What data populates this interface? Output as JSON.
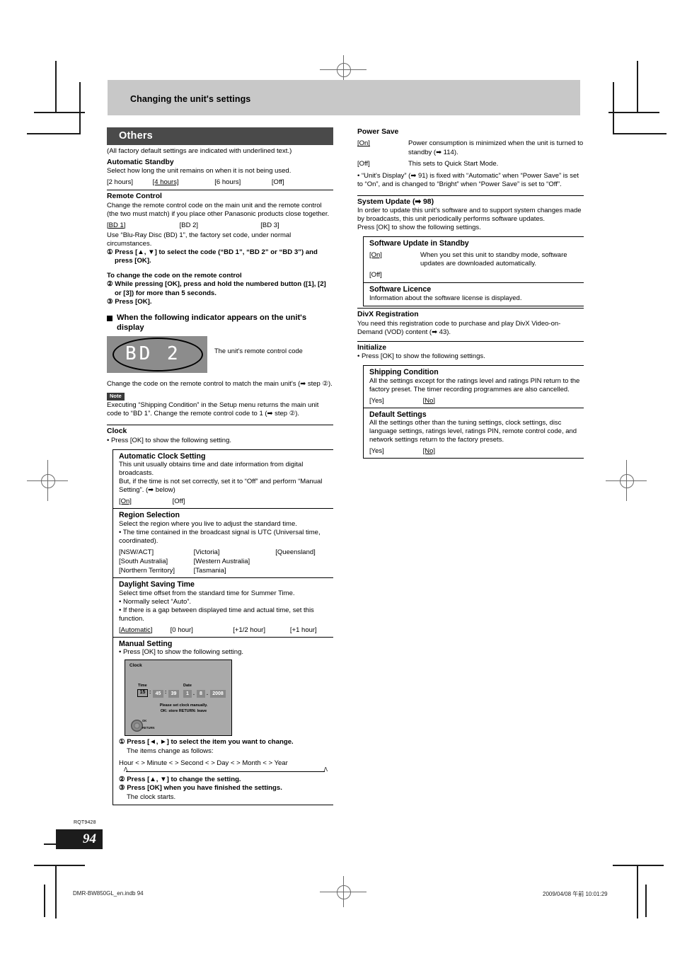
{
  "page": {
    "chapter": "Changing the unit's settings",
    "number": "94",
    "doc_code": "RQT9428",
    "footer_left": "DMR-BW850GL_en.indb   94",
    "footer_right": "2009/04/08   午前 10:01:29"
  },
  "left": {
    "section_title": "Others",
    "factory_note": "(All factory default settings are indicated with underlined text.)",
    "automatic_standby": {
      "title": "Automatic Standby",
      "body": "Select how long the unit remains on when it is not being used.",
      "options": [
        "[2 hours]",
        "[4 hours]",
        "[6 hours]",
        "[Off]"
      ],
      "default": "[4 hours]"
    },
    "remote_control": {
      "title": "Remote Control",
      "body": "Change the remote control code on the main unit and the remote control (the two must match) if you place other Panasonic products close together.",
      "options": [
        "[BD 1]",
        "[BD 2]",
        "[BD 3]"
      ],
      "default": "[BD 1]",
      "body2": "Use “Blu-Ray Disc (BD) 1”, the factory set code, under normal circumstances.",
      "step1": "① Press [▲, ▼] to select the code (“BD 1”, “BD 2” or “BD 3”) and press [OK].",
      "sub_head": "To change the code on the remote control",
      "step2": "② While pressing [OK], press and hold the numbered button ([1], [2] or [3]) for more than 5 seconds.",
      "step3": "③ Press [OK].",
      "indicator_head": "When the following indicator appears on the unit's display",
      "display_value": "BD 2",
      "display_caption": "The unit's remote control code",
      "after_display": "Change the code on the remote control to match the main unit's (➡ step ②).",
      "note_badge": "Note",
      "note_text": "Executing “Shipping Condition” in the Setup menu returns the main unit code to “BD 1”. Change the remote control code to 1 (➡ step ②)."
    },
    "clock": {
      "title": "Clock",
      "body": "• Press [OK] to show the following setting.",
      "automatic_clock_setting": {
        "title": "Automatic Clock Setting",
        "body": "This unit usually obtains time and date information from digital broadcasts.\nBut, if the time is not set correctly, set it to “Off” and perform “Manual Setting”. (➡ below)",
        "line1": "This unit usually obtains time and date information from digital broadcasts.",
        "line2": "But, if the time is not set correctly, set it to “Off” and perform “Manual Setting”. (➡ below)",
        "options": [
          "[On]",
          "[Off]"
        ],
        "default": "[On]"
      },
      "region_selection": {
        "title": "Region Selection",
        "line1": "Select the region where you live to adjust the standard time.",
        "line2": "• The time contained in the broadcast signal is UTC (Universal time, coordinated).",
        "options_row1": [
          "[NSW/ACT]",
          "[Victoria]",
          "[Queensland]"
        ],
        "options_row2": [
          "[South Australia]",
          "[Western Australia]"
        ],
        "options_row3": [
          "[Northern Territory]",
          "[Tasmania]"
        ]
      },
      "daylight_saving_time": {
        "title": "Daylight Saving Time",
        "line1": "Select time offset from the standard time for Summer Time.",
        "line2": "• Normally select “Auto”.",
        "line3": "• If there is a gap between displayed time and actual time, set this function.",
        "options": [
          "[Automatic]",
          "[0 hour]",
          "[+1/2 hour]",
          "[+1 hour]"
        ],
        "default": "[Automatic]"
      },
      "manual_setting": {
        "title": "Manual Setting",
        "body": "• Press [OK] to show the following setting.",
        "osd": {
          "screen_title": "Clock",
          "time_label": "Time",
          "date_label": "Date",
          "hour": "15",
          "minute": "45",
          "second": "39",
          "day": "1",
          "month": "8",
          "year": "2008",
          "time_sep": ":",
          "date_sep": ".",
          "message_line1": "Please set clock manually.",
          "message_line2": "OK: store   RETURN: leave",
          "knob_label_ok": "OK",
          "knob_label_return": "RETURN"
        },
        "step1": "① Press [◄, ►] to select the item you want to change.",
        "step1_sub": "The items change as follows:",
        "cycle": [
          "Hour",
          "Minute",
          "Second",
          "Day",
          "Month",
          "Year"
        ],
        "cycle_sep": "←→",
        "step2": "② Press [▲, ▼] to change the setting.",
        "step3": "③ Press [OK] when you have finished the settings.",
        "step3_sub": "The clock starts."
      }
    }
  },
  "right": {
    "power_save": {
      "title": "Power Save",
      "rows": [
        {
          "key": "[On]",
          "value": "Power consumption is minimized when the unit is turned to standby (➡ 114).",
          "underline": true
        },
        {
          "key": "[Off]",
          "value": "This sets to Quick Start Mode.",
          "underline": false
        }
      ],
      "note": "• “Unit's Display” (➡ 91) is fixed with “Automatic” when “Power Save” is set to “On”, and is changed to “Bright” when “Power Save” is set to “Off”."
    },
    "system_update": {
      "title": "System Update (➡ 98)",
      "line1": "In order to update this unit's software and to support system changes made by broadcasts, this unit periodically performs software updates.",
      "line2": "Press [OK] to show the following settings.",
      "software_update_in_standby": {
        "title": "Software Update in Standby",
        "rows": [
          {
            "key": "[On]",
            "value": "When you set this unit to standby mode, software updates are downloaded automatically.",
            "underline": true
          },
          {
            "key": "[Off]",
            "value": "",
            "underline": false
          }
        ]
      },
      "software_licence": {
        "title": "Software Licence",
        "body": "Information about the software license is displayed."
      }
    },
    "divx_registration": {
      "title": "DivX Registration",
      "body": "You need this registration code to purchase and play DivX Video-on-Demand (VOD) content (➡ 43)."
    },
    "initialize": {
      "title": "Initialize",
      "body": "• Press [OK] to show the following settings.",
      "shipping_condition": {
        "title": "Shipping Condition",
        "body": "All the settings except for the ratings level and ratings PIN return to the factory preset. The timer recording programmes are also cancelled.",
        "options": [
          "[Yes]",
          "[No]"
        ],
        "default": "[No]"
      },
      "default_settings": {
        "title": "Default Settings",
        "body": "All the settings other than the tuning settings, clock settings, disc language settings, ratings level, ratings PIN, remote control code, and network settings return to the factory presets.",
        "options": [
          "[Yes]",
          "[No]"
        ],
        "default": "[No]"
      }
    }
  }
}
